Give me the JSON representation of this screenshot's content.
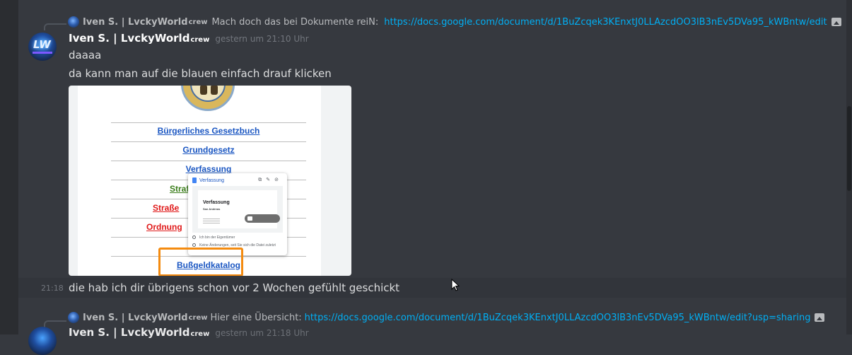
{
  "reply1": {
    "author": "Iven S. | LvckyWorld",
    "tag": "crew",
    "text": "Mach doch das bei Dokumente reiN:",
    "link": "https://docs.google.com/document/d/1BuZcqek3KEnxtJ0LLAzcdOO3lB3nEv5DVa95_kWBntw/edit"
  },
  "message": {
    "author": "Iven S. | LvckyWorld",
    "tag": "crew",
    "timestamp": "gestern um 21:10 Uhr",
    "line1": "daaaa",
    "line2": "da kann man auf die blauen einfach drauf klicken"
  },
  "attachment": {
    "links": [
      {
        "label": "Bürgerliches Gesetzbuch",
        "color": "#1a56c2"
      },
      {
        "label": "Grundgesetz",
        "color": "#1a56c2"
      },
      {
        "label": "Verfassung",
        "color": "#1a56c2"
      },
      {
        "label": "Straf",
        "color": "#3a7d1a"
      },
      {
        "label": "Straße",
        "color": "#e01a1a"
      },
      {
        "label": "Ordnung",
        "color": "#e01a1a"
      },
      {
        "label": "Bußgeldkatalog",
        "color": "#1a56c2"
      }
    ],
    "popup": {
      "title": "Verfassung",
      "preview_title": "Verfassung",
      "preview_subtitle": "San Andreas",
      "owner_text": "Ich bin der Eigentümer",
      "changes_text": "Keine Änderungen, seit Sie sich die Datei zuletzt"
    },
    "highlight_color": "#f48b10"
  },
  "followup": {
    "time": "21:18",
    "text": "die hab ich dir übrigens schon vor 2 Wochen gefühlt geschickt"
  },
  "reply2": {
    "author": "Iven S. | LvckyWorld",
    "tag": "crew",
    "text": "Hier eine Übersicht:",
    "link": "https://docs.google.com/document/d/1BuZcqek3KEnxtJ0LLAzcdOO3lB3nEv5DVa95_kWBntw/edit?usp=sharing"
  },
  "next_message": {
    "author": "Iven S. | LvckyWorld",
    "tag": "crew",
    "timestamp": "gestern um 21:18 Uhr"
  },
  "avatar_text": "LW",
  "colors": {
    "background": "#36393f",
    "link": "#00aff4",
    "muted": "#72767d"
  }
}
